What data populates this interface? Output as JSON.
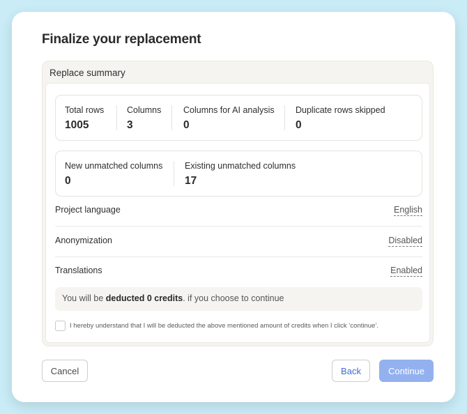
{
  "dialog": {
    "title": "Finalize your replacement"
  },
  "summary": {
    "title": "Replace summary",
    "stats_row1": [
      {
        "label": "Total rows",
        "value": "1005"
      },
      {
        "label": "Columns",
        "value": "3"
      },
      {
        "label": "Columns for AI analysis",
        "value": "0"
      },
      {
        "label": "Duplicate rows skipped",
        "value": "0"
      }
    ],
    "stats_row2": [
      {
        "label": "New unmatched columns",
        "value": "0"
      },
      {
        "label": "Existing unmatched columns",
        "value": "17"
      }
    ],
    "settings": [
      {
        "label": "Project language",
        "value": "English"
      },
      {
        "label": "Anonymization",
        "value": "Disabled"
      },
      {
        "label": "Translations",
        "value": "Enabled"
      }
    ],
    "credits": {
      "prefix": "You will be ",
      "bold": "deducted 0 credits",
      "suffix": ". if you choose to continue"
    },
    "consent": {
      "text": "I hereby understand that I will be deducted the above mentioned amount of credits when I click ‘continue’.",
      "checked": false
    }
  },
  "footer": {
    "cancel_label": "Cancel",
    "back_label": "Back",
    "continue_label": "Continue"
  },
  "colors": {
    "background": "#c9ecf7",
    "primary_disabled": "#93b1ef",
    "link": "#3d6ad6"
  }
}
